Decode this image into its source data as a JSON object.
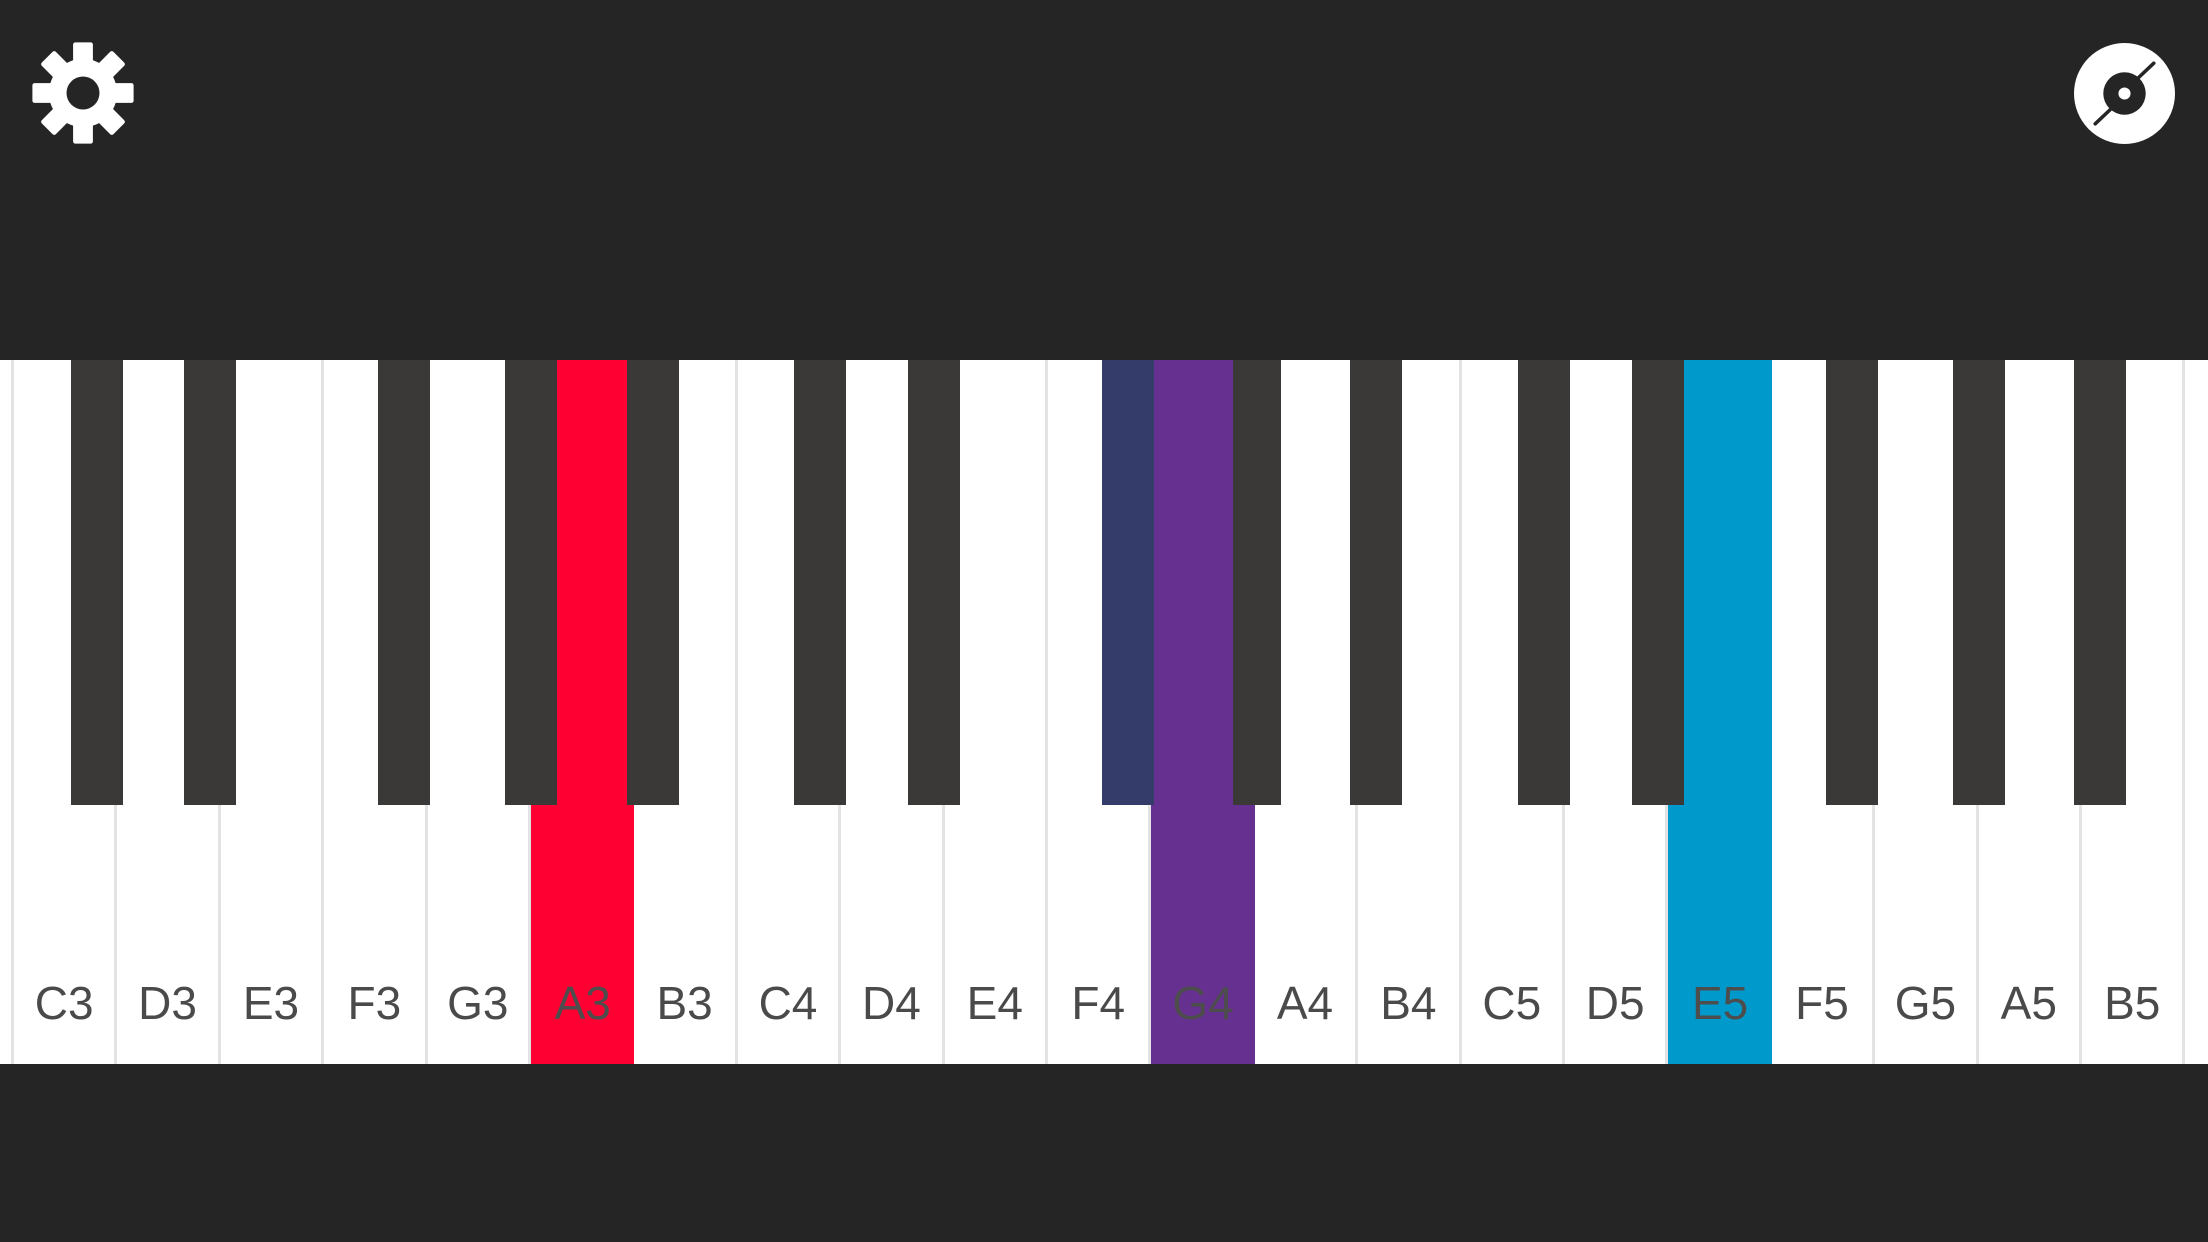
{
  "app": {
    "background_color": "#252525",
    "settings_icon": "gear-icon",
    "record_icon": "vinyl-record-icon"
  },
  "keyboard": {
    "white_keys": [
      {
        "note": "C3",
        "highlight": null
      },
      {
        "note": "D3",
        "highlight": null
      },
      {
        "note": "E3",
        "highlight": null
      },
      {
        "note": "F3",
        "highlight": null
      },
      {
        "note": "G3",
        "highlight": null
      },
      {
        "note": "A3",
        "highlight": "#ff0033"
      },
      {
        "note": "B3",
        "highlight": null
      },
      {
        "note": "C4",
        "highlight": null
      },
      {
        "note": "D4",
        "highlight": null
      },
      {
        "note": "E4",
        "highlight": null
      },
      {
        "note": "F4",
        "highlight": null
      },
      {
        "note": "G4",
        "highlight": "#663090"
      },
      {
        "note": "A4",
        "highlight": null
      },
      {
        "note": "B4",
        "highlight": null
      },
      {
        "note": "C5",
        "highlight": null
      },
      {
        "note": "D5",
        "highlight": null
      },
      {
        "note": "E5",
        "highlight": "#0099cc"
      },
      {
        "note": "F5",
        "highlight": null
      },
      {
        "note": "G5",
        "highlight": null
      },
      {
        "note": "A5",
        "highlight": null
      },
      {
        "note": "B5",
        "highlight": null
      }
    ],
    "black_keys": [
      {
        "note": "C#3",
        "highlight": null
      },
      {
        "note": "D#3",
        "highlight": null
      },
      {
        "note": "F#3",
        "highlight": null
      },
      {
        "note": "G#3",
        "highlight": null
      },
      {
        "note": "A#3",
        "highlight": null
      },
      {
        "note": "C#4",
        "highlight": null
      },
      {
        "note": "D#4",
        "highlight": null
      },
      {
        "note": "F#4",
        "highlight": "#343c6a"
      },
      {
        "note": "G#4",
        "highlight": null
      },
      {
        "note": "A#4",
        "highlight": null
      },
      {
        "note": "C#5",
        "highlight": null
      },
      {
        "note": "D#5",
        "highlight": null
      },
      {
        "note": "F#5",
        "highlight": null
      },
      {
        "note": "G#5",
        "highlight": null
      },
      {
        "note": "A#5",
        "highlight": null
      }
    ],
    "white_key_color": "#ffffff",
    "black_key_color": "#3a3938",
    "label_color": "#4a4a4a",
    "highlighted_label_color": "#4d4d4d",
    "highlight_colors": {
      "red": "#ff0033",
      "purple": "#663090",
      "navy": "#343c6a",
      "blue": "#0099cc"
    }
  }
}
